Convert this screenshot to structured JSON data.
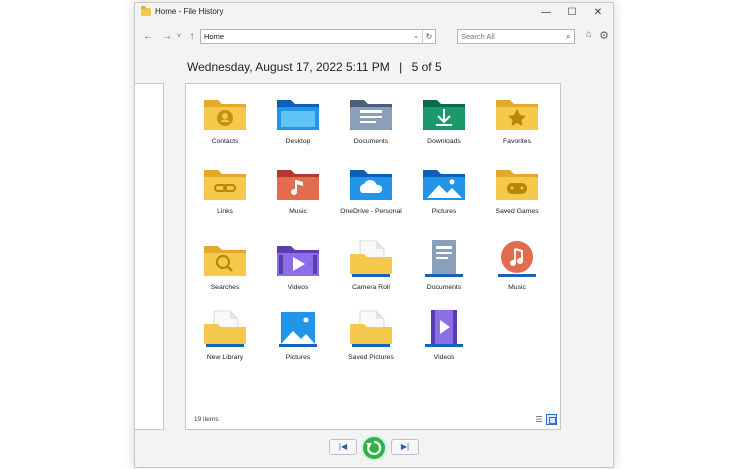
{
  "window": {
    "title": "Home - File History"
  },
  "titlebar": {
    "minimize": "—",
    "maximize": "☐",
    "close": "✕"
  },
  "toolbar": {
    "back": "←",
    "forward": "→",
    "recent": "˅",
    "up": "↑",
    "address": "Home",
    "search_placeholder": "Search All"
  },
  "header": {
    "date": "Wednesday, August 17, 2022 5:11 PM",
    "separator": "|",
    "position": "5 of 5"
  },
  "items": [
    {
      "label": "Contacts",
      "icon": "contacts-folder-icon"
    },
    {
      "label": "Desktop",
      "icon": "desktop-folder-icon"
    },
    {
      "label": "Documents",
      "icon": "documents-folder-icon"
    },
    {
      "label": "Downloads",
      "icon": "downloads-folder-icon"
    },
    {
      "label": "Favorites",
      "icon": "favorites-folder-icon"
    },
    {
      "label": "Links",
      "icon": "links-folder-icon"
    },
    {
      "label": "Music",
      "icon": "music-folder-icon"
    },
    {
      "label": "OneDrive - Personal",
      "icon": "onedrive-folder-icon"
    },
    {
      "label": "Pictures",
      "icon": "pictures-folder-icon"
    },
    {
      "label": "Saved Games",
      "icon": "saved-games-folder-icon"
    },
    {
      "label": "Searches",
      "icon": "searches-folder-icon"
    },
    {
      "label": "Videos",
      "icon": "videos-folder-icon"
    },
    {
      "label": "Camera Roll",
      "icon": "camera-roll-folder-icon"
    },
    {
      "label": "Documents",
      "icon": "documents-library-icon"
    },
    {
      "label": "Music",
      "icon": "music-library-icon"
    },
    {
      "label": "New Library",
      "icon": "new-library-icon"
    },
    {
      "label": "Pictures",
      "icon": "pictures-library-icon"
    },
    {
      "label": "Saved Pictures",
      "icon": "saved-pictures-folder-icon"
    },
    {
      "label": "Videos",
      "icon": "videos-library-icon"
    }
  ],
  "status": {
    "count": "19 items"
  },
  "playback": {
    "previous": "|◀",
    "next": "▶|"
  },
  "colors": {
    "folder_yellow": "#f5c94c",
    "folder_blue": "#1e88d8",
    "restore_green": "#2eb34a"
  }
}
